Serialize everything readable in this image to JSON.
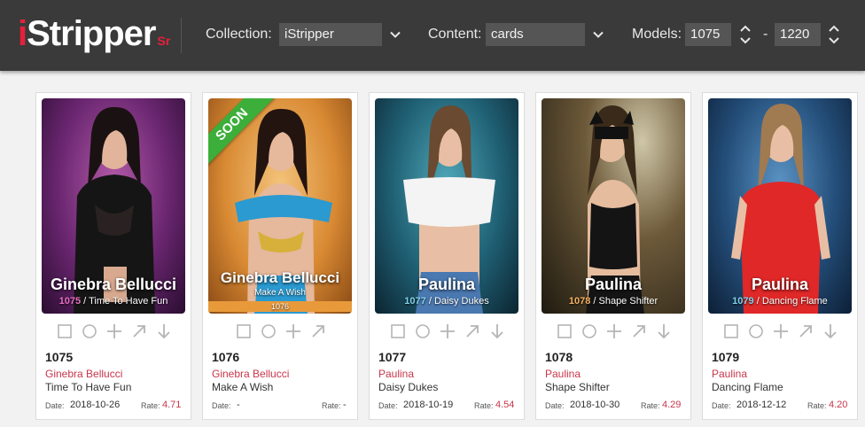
{
  "header": {
    "logo_main": "Stripper",
    "logo_i": "i",
    "logo_sr": "Sr",
    "collection_label": "Collection:",
    "collection_value": "iStripper",
    "content_label": "Content:",
    "content_value": "cards",
    "models_label": "Models:",
    "models_from": "1075",
    "models_to": "1220",
    "dash": "-"
  },
  "labels": {
    "date": "Date:",
    "rate": "Rate:"
  },
  "cards": [
    {
      "number": "1075",
      "model": "Ginebra Bellucci",
      "title": "Time To Have Fun",
      "date": "2018-10-26",
      "rate": "4.71",
      "overlay_name": "Ginebra Bellucci",
      "overlay_num": "1075",
      "overlay_title": " / Time To Have Fun",
      "accent": "#c44fa8"
    },
    {
      "number": "1076",
      "model": "Ginebra Bellucci",
      "title": "Make A Wish",
      "date": "-",
      "rate": "-",
      "overlay_name": "Ginebra Bellucci",
      "overlay_line2": "Make A Wish",
      "overlay_line3": "1076",
      "ribbon": "SOON",
      "accent": "#e89a3a"
    },
    {
      "number": "1077",
      "model": "Paulina",
      "title": "Daisy Dukes",
      "date": "2018-10-19",
      "rate": "4.54",
      "overlay_name": "Paulina",
      "overlay_num": "1077",
      "overlay_title": " / Daisy Dukes",
      "accent": "#3fb7d2"
    },
    {
      "number": "1078",
      "model": "Paulina",
      "title": "Shape Shifter",
      "date": "2018-10-30",
      "rate": "4.29",
      "overlay_name": "Paulina",
      "overlay_num": "1078",
      "overlay_title": " / Shape Shifter",
      "accent": "#f0a04a"
    },
    {
      "number": "1079",
      "model": "Paulina",
      "title": "Dancing Flame",
      "date": "2018-12-12",
      "rate": "4.20",
      "overlay_name": "Paulina",
      "overlay_num": "1079",
      "overlay_title": " / Dancing Flame",
      "accent": "#3fb7d2"
    }
  ],
  "icons": [
    "square-icon",
    "circle-icon",
    "plus-icon",
    "arrow-up-right-icon",
    "arrow-down-icon"
  ]
}
